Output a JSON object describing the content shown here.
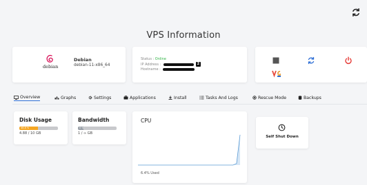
{
  "page": {
    "title": "VPS Information"
  },
  "header": {
    "refresh_icon": "refresh-icon"
  },
  "os": {
    "logo_text": "debian",
    "name": "Debian",
    "version": "debian-11-x86_64"
  },
  "status": {
    "status_label": "Status : ",
    "status_value": "Online",
    "ip_label": "IP Address : ",
    "ip_badge": "2",
    "hostname_label": "Hostname : "
  },
  "power": {
    "stop_icon": "stop-icon",
    "restart_icon": "restart-icon",
    "poweroff_icon": "power-icon",
    "vnc_label": "VΩ"
  },
  "tabs": [
    {
      "label": "Overview",
      "icon": "monitor-icon"
    },
    {
      "label": "Graphs",
      "icon": "bar-chart-icon"
    },
    {
      "label": "Settings",
      "icon": "gear-icon"
    },
    {
      "label": "Applications",
      "icon": "apps-icon"
    },
    {
      "label": "Install",
      "icon": "download-icon"
    },
    {
      "label": "Tasks And Logs",
      "icon": "list-icon"
    },
    {
      "label": "Rescue Mode",
      "icon": "lifebuoy-icon"
    },
    {
      "label": "Backups",
      "icon": "database-icon"
    }
  ],
  "disk": {
    "title": "Disk Usage",
    "percent_label": "48.8 %",
    "fill": 0.488,
    "value": "4.88 / 10 GB"
  },
  "bandwidth": {
    "title": "Bandwidth",
    "percent_label": "0 %",
    "fill": 0.0,
    "value": "1 / ∞ GB"
  },
  "cpu": {
    "title": "CPU",
    "used": "6.4% Used",
    "chart_data": {
      "type": "area",
      "values": [
        0,
        0,
        0,
        0,
        0,
        0,
        0,
        0,
        0,
        0,
        0,
        0,
        0,
        0,
        0,
        0,
        0,
        0,
        0,
        0,
        0,
        0,
        0,
        0,
        0,
        0,
        0,
        0,
        0.3,
        6.4
      ]
    }
  },
  "actions": {
    "shutdown_label": "Self Shut Down"
  },
  "colors": {
    "accent": "#2f6fd6",
    "online": "#2fb344",
    "disk_fill": "#f5a623",
    "power": "#e53935",
    "cpu_line": "#5b9bd5"
  }
}
